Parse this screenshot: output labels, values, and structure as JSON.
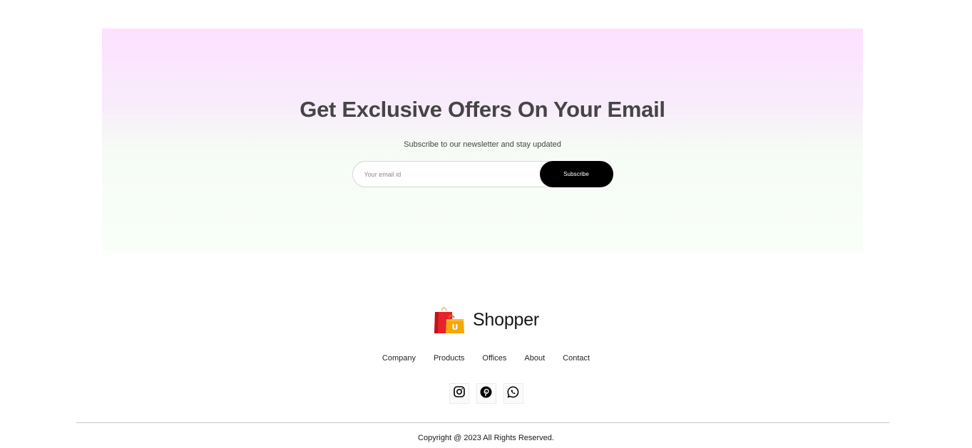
{
  "newsletter": {
    "title": "Get Exclusive Offers On Your Email",
    "subtitle": "Subscribe to our newsletter and stay updated",
    "email_placeholder": "Your email id",
    "email_value": "",
    "subscribe_label": "Subscribe"
  },
  "footer": {
    "brand_name": "Shopper",
    "links": [
      "Company",
      "Products",
      "Offices",
      "About",
      "Contact"
    ],
    "social": [
      {
        "icon": "instagram-icon"
      },
      {
        "icon": "pinterest-icon"
      },
      {
        "icon": "whatsapp-icon"
      }
    ],
    "copyright": "Copyright @ 2023 All Rights Reserved."
  },
  "colors": {
    "gradient_top": "#fde1ff",
    "gradient_bottom": "#f9fef9",
    "button_bg": "#000000",
    "title_text": "#454545"
  }
}
